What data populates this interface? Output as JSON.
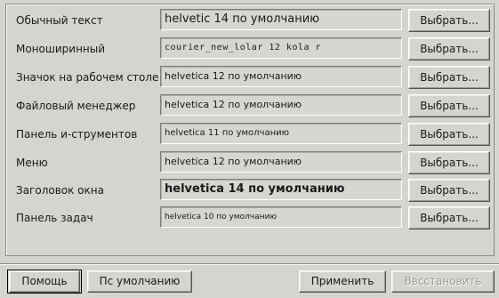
{
  "font_rows": [
    {
      "label": "Обычный текст",
      "value": "helvetic 14 по умолчанию",
      "button": "Выбрать..."
    },
    {
      "label": "Моноширинный",
      "value": "courier_new_lolar 12 kola r",
      "button": "Выбрать..."
    },
    {
      "label": "Значок на рабочем столе",
      "value": "helvetica 12 по умолчанию",
      "button": "Выбрать..."
    },
    {
      "label": "Файловый менеджер",
      "value": "helvetica 12 по умолчанию",
      "button": "Выбрать..."
    },
    {
      "label": "Панель и-струментов",
      "value": "helvetica 11 по умолчанию",
      "button": "Выбрать..."
    },
    {
      "label": "Меню",
      "value": "helvetica 12 по умолчанию",
      "button": "Выбрать..."
    },
    {
      "label": "Заголовок окна",
      "value": "helvetica 14 по умолчанию",
      "button": "Выбрать..."
    },
    {
      "label": "Панель задач",
      "value": "helvetica 10 по умолчанию",
      "button": "Выбрать..."
    }
  ],
  "footer": {
    "help": "Помощь",
    "defaults": "Пс умолчанию",
    "apply": "Применить",
    "restore": "Ввсстановить"
  }
}
